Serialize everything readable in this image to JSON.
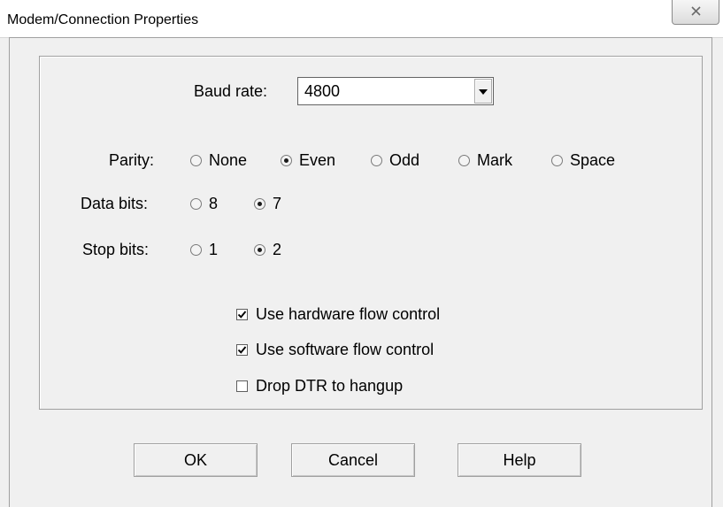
{
  "window": {
    "title": "Modem/Connection Properties",
    "close_glyph": "X"
  },
  "baud": {
    "label": "Baud rate:",
    "value": "4800"
  },
  "parity": {
    "label": "Parity:",
    "options": [
      "None",
      "Even",
      "Odd",
      "Mark",
      "Space"
    ],
    "selected": "Even"
  },
  "data_bits": {
    "label": "Data bits:",
    "options": [
      "8",
      "7"
    ],
    "selected": "7"
  },
  "stop_bits": {
    "label": "Stop bits:",
    "options": [
      "1",
      "2"
    ],
    "selected": "2"
  },
  "checkboxes": [
    {
      "label": "Use hardware flow control",
      "checked": true
    },
    {
      "label": "Use software flow control",
      "checked": true
    },
    {
      "label": "Drop DTR to hangup",
      "checked": false
    }
  ],
  "buttons": {
    "ok": "OK",
    "cancel": "Cancel",
    "help": "Help"
  }
}
